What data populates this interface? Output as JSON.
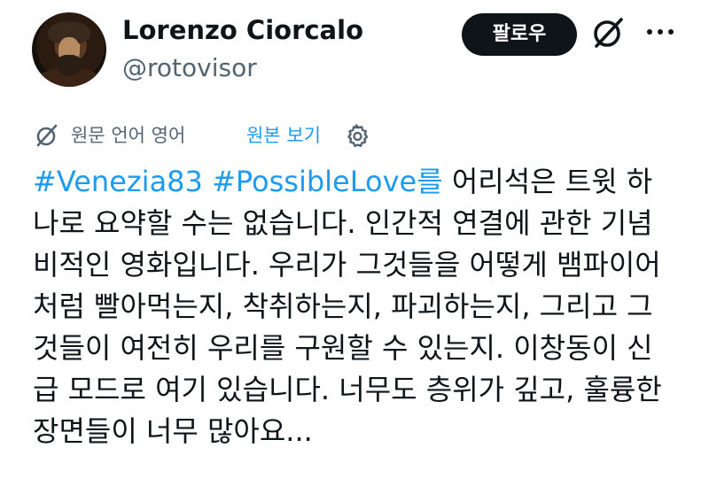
{
  "user": {
    "name": "Lorenzo Ciorcalo",
    "handle": "@rotovisor"
  },
  "header": {
    "follow_label": "팔로우"
  },
  "icons": {
    "grok": "grok-icon",
    "more": "more-icon",
    "translate": "translate-icon",
    "settings": "gear-icon"
  },
  "translation": {
    "label": "원문 언어 영어",
    "link": "원본 보기"
  },
  "tweet": {
    "hashtag1": "#Venezia83",
    "hashtag2": "#PossibleLove를",
    "line1_rest": " 어리석은 트윗 하",
    "lines": [
      "나로 요약할 수는 없습니다. 인간적 연결에 관한 기념",
      "비적인 영화입니다. 우리가 그것들을 어떻게 뱀파이어",
      "처럼 빨아먹는지, 착취하는지, 파괴하는지, 그리고 그",
      "것들이 여전히 우리를 구원할 수 있는지. 이창동이 신",
      "급 모드로 여기 있습니다. 너무도 층위가 깊고, 훌륭한",
      "장면들이 너무 많아요..."
    ]
  },
  "colors": {
    "link": "#1d9bf0",
    "text": "#0f1419",
    "secondary": "#536471",
    "button_bg": "#0f1419"
  }
}
